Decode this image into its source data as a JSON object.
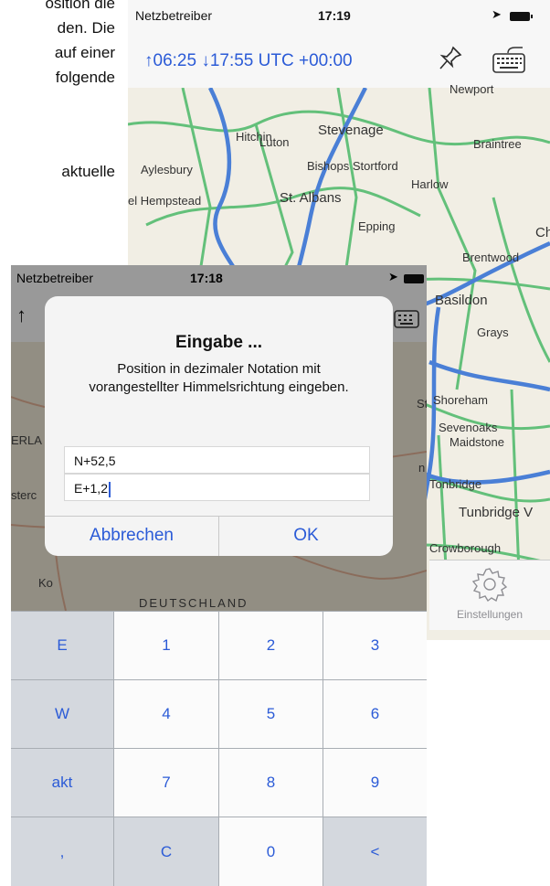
{
  "document": {
    "lines": [
      "osition die",
      "den. Die",
      "auf einer",
      "folgende",
      "aktuelle"
    ]
  },
  "back_screen": {
    "status": {
      "carrier": "Netzbetreiber",
      "time": "17:19"
    },
    "nav": {
      "times_text": "↑06:25 ↓17:55  UTC +00:00"
    },
    "map_labels": [
      "Newport",
      "Hitchin",
      "Stevenage",
      "Braintree",
      "Luton",
      "Bishops Stortford",
      "Aylesbury",
      "Harlow",
      "el Hempstead",
      "St. Albans",
      "Epping",
      "Ch",
      "Brentwood",
      "Basildon",
      "Grays",
      "Shoreham",
      "Sevenoaks",
      "Maidstone",
      "Tonbridge",
      "Tunbridge V",
      "Crowborough"
    ],
    "tab": {
      "label": "Einstellungen"
    }
  },
  "front_screen": {
    "status": {
      "carrier": "Netzbetreiber",
      "time": "17:18"
    },
    "nav": {
      "arrow": "↑"
    },
    "map_labels": [
      "ERLA",
      "sterc",
      "N",
      "Ko",
      "St",
      "n",
      "DEUTSCHLAND"
    ],
    "alert": {
      "title": "Eingabe ...",
      "message": "Position in dezimaler Notation mit vorangestellter Himmelsrichtung eingeben.",
      "field1": "N+52,5",
      "field2": "E+1,2",
      "cancel": "Abbrechen",
      "ok": "OK"
    },
    "keypad": {
      "rows": [
        [
          "E",
          "1",
          "2",
          "3"
        ],
        [
          "W",
          "4",
          "5",
          "6"
        ],
        [
          "akt",
          "7",
          "8",
          "9"
        ],
        [
          ",",
          "C",
          "0",
          "<"
        ]
      ]
    }
  },
  "colors": {
    "accent": "#2b5bd7",
    "road_major": "#4a7fd6",
    "road_minor": "#5fbf7a"
  }
}
